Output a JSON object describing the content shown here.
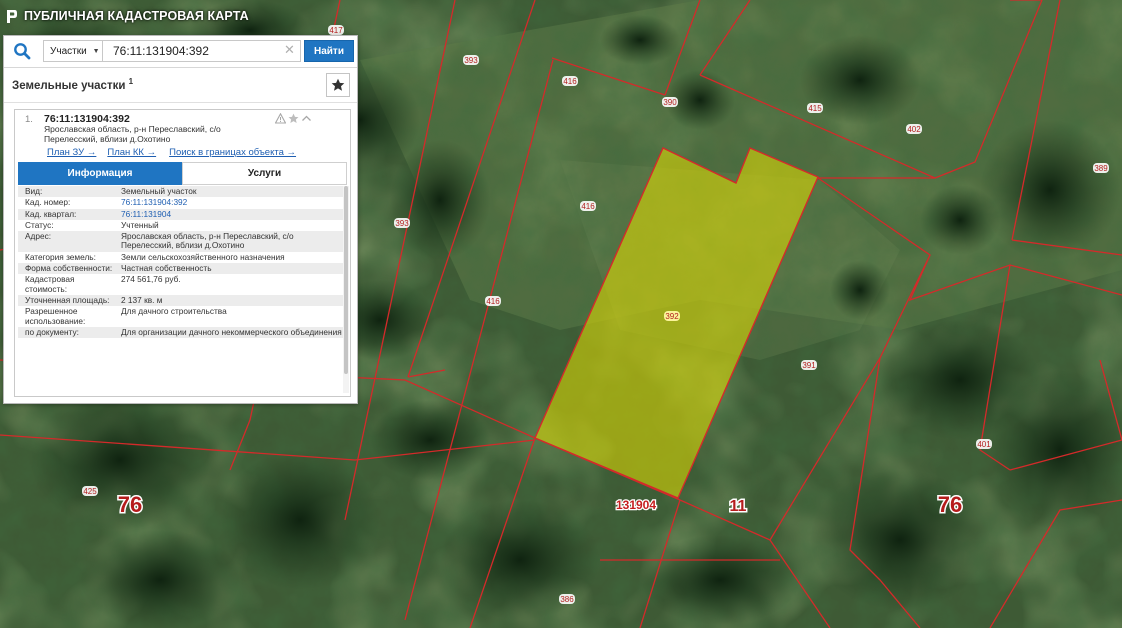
{
  "app": {
    "title": "ПУБЛИЧНАЯ КАДАСТРОВАЯ КАРТА"
  },
  "search": {
    "type_label": "Участки",
    "value": "76:11:131904:392",
    "find_label": "Найти"
  },
  "section": {
    "title": "Земельные участки",
    "count": "1"
  },
  "result": {
    "num": "1.",
    "cad": "76:11:131904:392",
    "addr": "Ярославская область, р-н Переславский, с/о Перелесский, вблизи д.Охотино",
    "links": {
      "plan_zu": "План ЗУ →",
      "plan_kk": "План КК →",
      "search_in": "Поиск в границах объекта →"
    }
  },
  "tabs": {
    "info": "Информация",
    "services": "Услуги"
  },
  "info": [
    {
      "k": "Вид:",
      "v": "Земельный участок"
    },
    {
      "k": "Кад. номер:",
      "v": "76:11:131904:392"
    },
    {
      "k": "Кад. квартал:",
      "v": "76:11:131904"
    },
    {
      "k": "Статус:",
      "v": "Учтенный"
    },
    {
      "k": "Адрес:",
      "v": "Ярославская область, р-н Переславский, с/о Перелесский, вблизи д.Охотино"
    },
    {
      "k": "Категория земель:",
      "v": "Земли сельскохозяйственного назначения"
    },
    {
      "k": "Форма собственности:",
      "v": "Частная собственность"
    },
    {
      "k": "Кадастровая стоимость:",
      "v": "274 561,76 руб."
    },
    {
      "k": "Уточненная площадь:",
      "v": "2 137 кв. м"
    },
    {
      "k": "Разрешенное использование:",
      "v": "Для дачного строительства"
    },
    {
      "k": "по документу:",
      "v": "Для организации дачного некоммерческого объединения"
    }
  ],
  "map": {
    "parcel_labels": [
      "417",
      "393",
      "416",
      "390",
      "415",
      "402",
      "389",
      "416",
      "393",
      "392",
      "416",
      "391",
      "401",
      "425",
      "386"
    ],
    "quarter_labels": [
      "131904",
      "76",
      "11",
      "76"
    ],
    "colors": {
      "boundary": "#d42a2a",
      "highlight": "#e6e000",
      "label_text": "#b32020"
    }
  }
}
